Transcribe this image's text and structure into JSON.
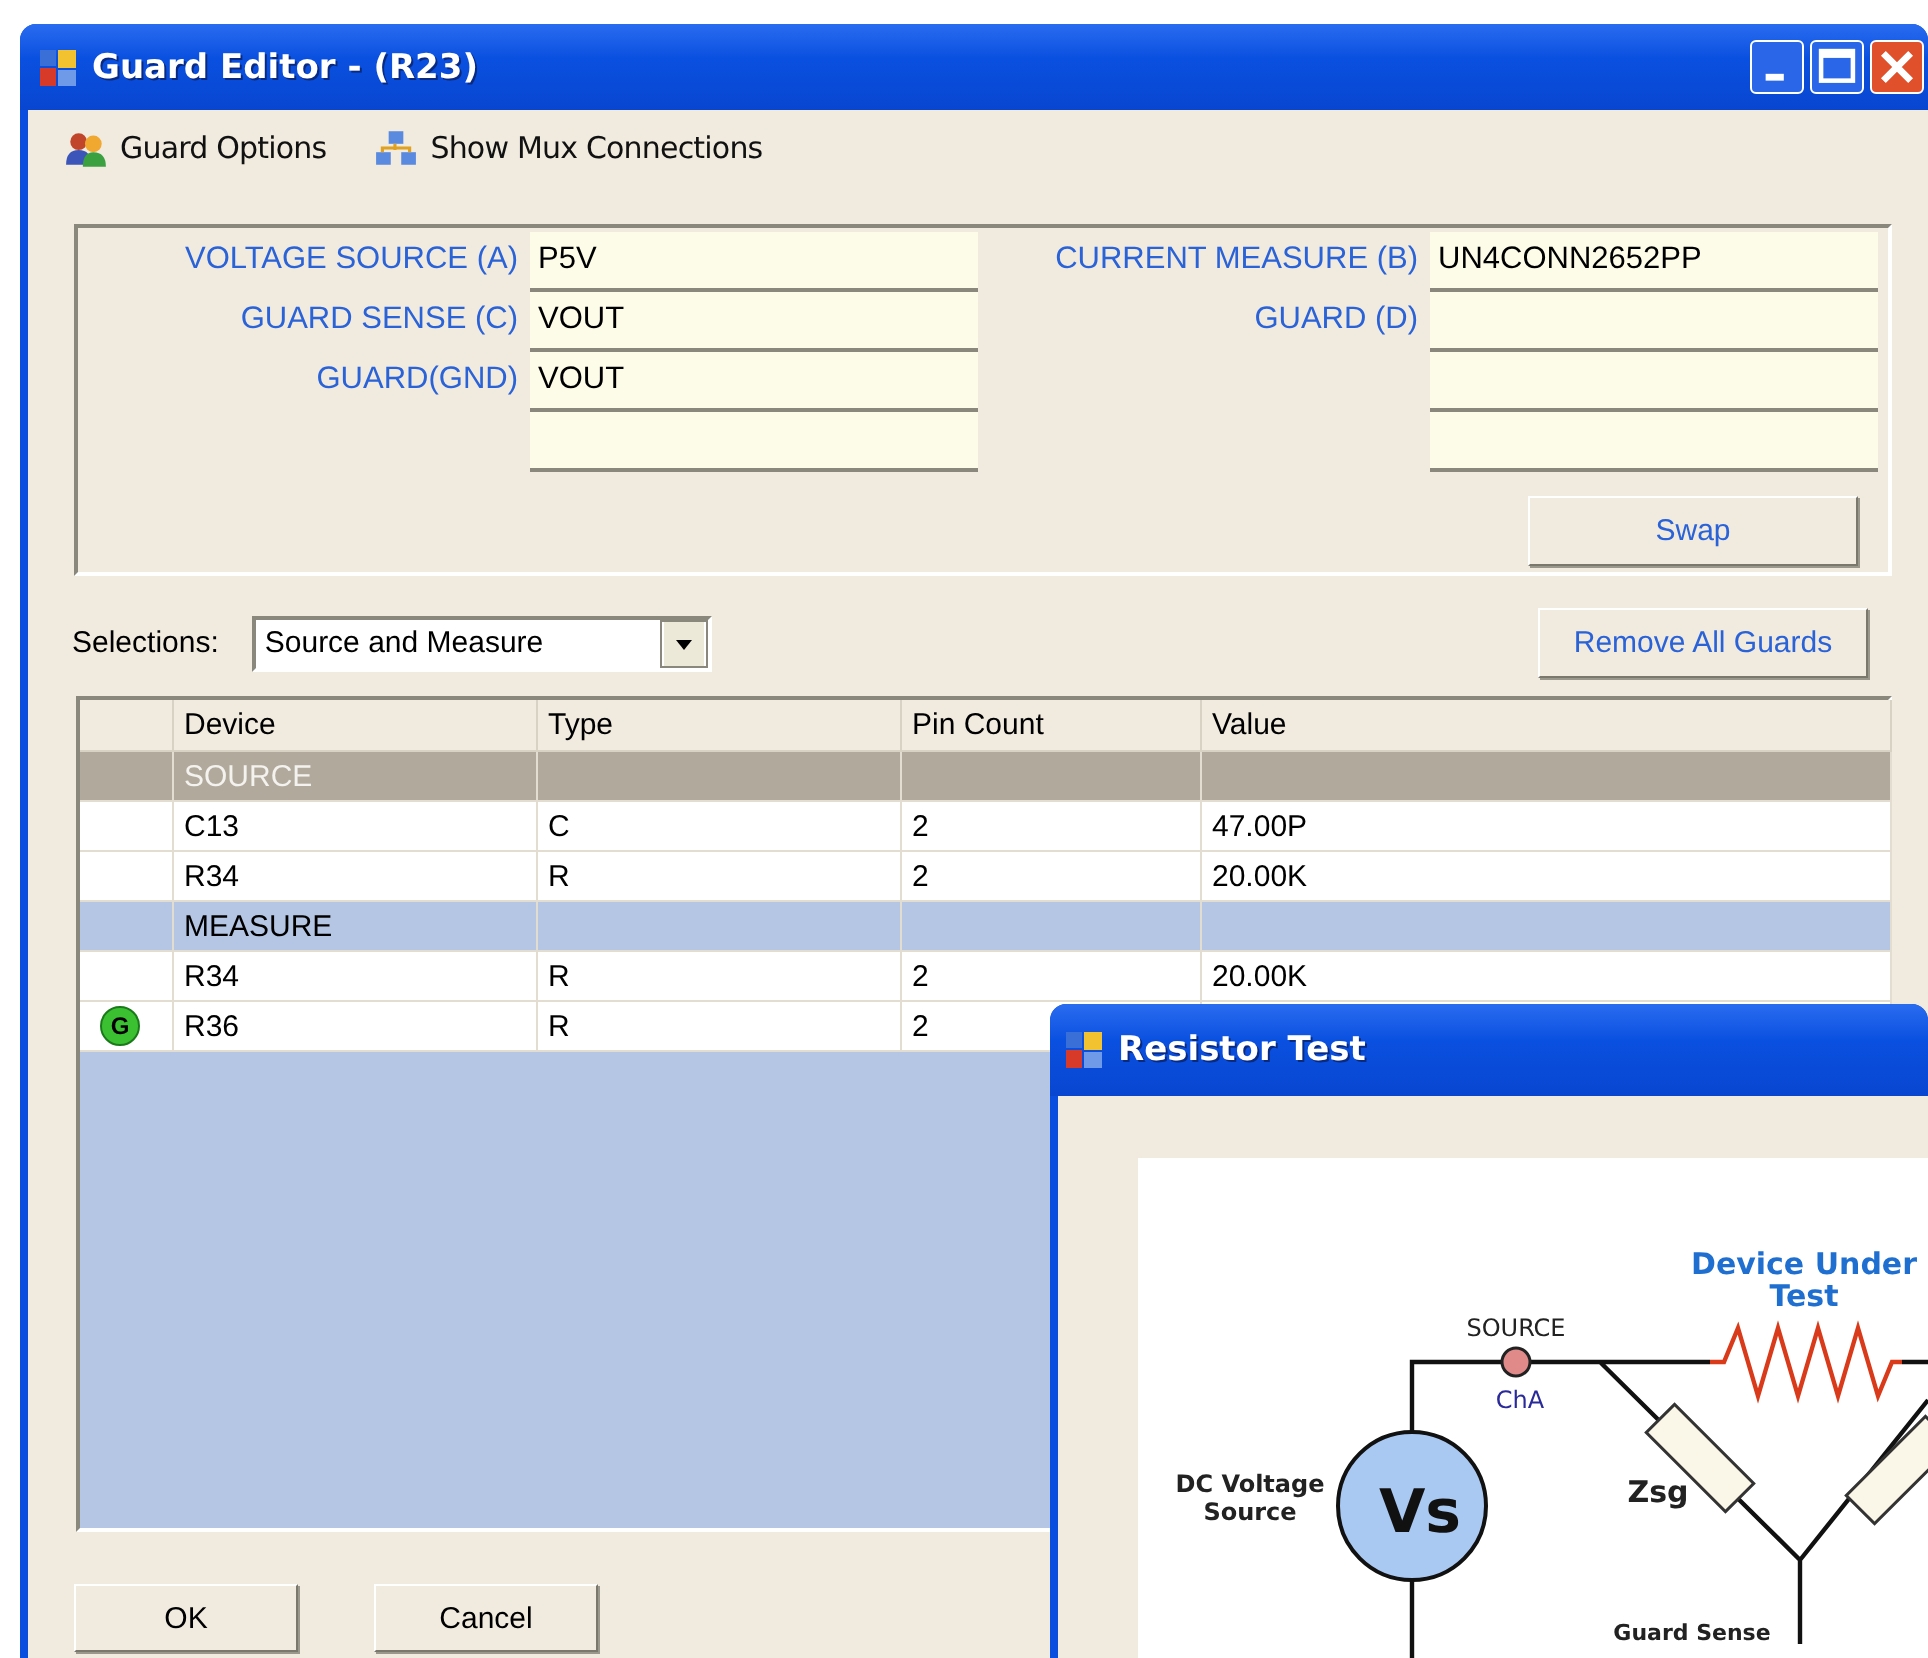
{
  "window": {
    "title": "Guard Editor - (R23)"
  },
  "toolbar": [
    {
      "kind": "options",
      "label": "Guard Options"
    },
    {
      "kind": "mux",
      "label": "Show Mux Connections"
    }
  ],
  "connections": {
    "left": [
      {
        "kind": "field",
        "label": "VOLTAGE SOURCE (A)",
        "value": "P5V"
      },
      {
        "kind": "field",
        "label": "GUARD SENSE (C)",
        "value": "VOUT"
      },
      {
        "kind": "field",
        "label": "GUARD(GND)",
        "value": "VOUT"
      },
      {
        "kind": "blank"
      }
    ],
    "right": [
      {
        "kind": "field",
        "label": "CURRENT MEASURE (B)",
        "value": "UN4CONN2652PP"
      },
      {
        "kind": "field",
        "label": "GUARD (D)"
      },
      {
        "kind": "blank"
      },
      {
        "kind": "blank"
      }
    ]
  },
  "swap_button": "Swap",
  "selections": {
    "label": "Selections:",
    "value": "Source and Measure"
  },
  "remove_button": "Remove All Guards",
  "table": {
    "columns": [
      "Device",
      "Type",
      "Pin Count",
      "Value"
    ],
    "rows": [
      {
        "kind": "group",
        "device": "SOURCE",
        "selected": true
      },
      {
        "kind": "device",
        "device": "C13",
        "type": "C",
        "pin_count": "2",
        "value": "47.00P",
        "selected": false
      },
      {
        "kind": "device",
        "device": "R34",
        "type": "R",
        "pin_count": "2",
        "value": "20.00K",
        "selected": false
      },
      {
        "kind": "group",
        "device": "MEASURE",
        "selected": false
      },
      {
        "kind": "device",
        "device": "R34",
        "type": "R",
        "pin_count": "2",
        "value": "20.00K",
        "selected": false
      },
      {
        "kind": "device",
        "device": "R36",
        "type": "R",
        "pin_count": "2",
        "badge": "G",
        "selected": false
      }
    ]
  },
  "buttons": [
    "OK",
    "Cancel"
  ],
  "resistor_window": {
    "title": "Resistor Test",
    "labels": [
      {
        "kind": "device",
        "lines": [
          "Device Under",
          "Test"
        ]
      },
      {
        "kind": "node",
        "lines": [
          "SOURCE"
        ]
      },
      {
        "kind": "channel",
        "lines": [
          "ChA"
        ]
      },
      {
        "kind": "source",
        "lines": [
          "DC Voltage",
          "Source"
        ]
      },
      {
        "kind": "symbol",
        "lines": [
          "Vs"
        ]
      },
      {
        "kind": "impedance",
        "lines": [
          "Zsg"
        ]
      },
      {
        "kind": "sense",
        "lines": [
          "Guard Sense"
        ]
      }
    ]
  }
}
